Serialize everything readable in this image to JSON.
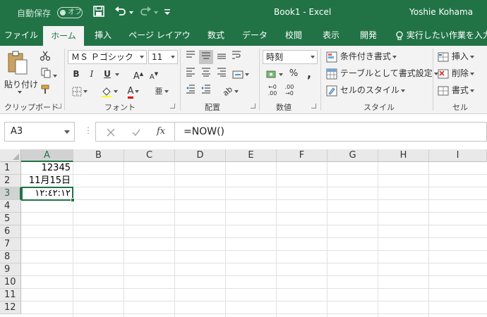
{
  "title_bar": {
    "autosave_label": "自動保存",
    "autosave_state": "オフ",
    "doc_title": "Book1  -  Excel",
    "user_name": "Yoshie Kohama"
  },
  "tabs": [
    {
      "label": "ファイル",
      "active": false
    },
    {
      "label": "ホーム",
      "active": true
    },
    {
      "label": "挿入",
      "active": false
    },
    {
      "label": "ページ レイアウト",
      "active": false
    },
    {
      "label": "数式",
      "active": false
    },
    {
      "label": "データ",
      "active": false
    },
    {
      "label": "校閲",
      "active": false
    },
    {
      "label": "表示",
      "active": false
    },
    {
      "label": "開発",
      "active": false
    },
    {
      "label": "実行したい作業を入力",
      "active": false
    }
  ],
  "ribbon": {
    "clipboard": {
      "paste_label": "貼り付け",
      "group_label": "クリップボード"
    },
    "font": {
      "font_name": "ＭＳ Ｐゴシック",
      "font_size": "11",
      "bold": "B",
      "italic": "I",
      "underline": "U",
      "group_label": "フォント"
    },
    "alignment": {
      "group_label": "配置"
    },
    "number": {
      "format": "時刻",
      "percent": "%",
      "group_label": "数値"
    },
    "styles": {
      "conditional": "条件付き書式",
      "table": "テーブルとして書式設定",
      "cell_styles": "セルのスタイル",
      "group_label": "スタイル"
    },
    "cells": {
      "insert": "挿入",
      "delete": "削除",
      "format": "書式",
      "group_label": "セル"
    }
  },
  "formula_bar": {
    "name_box": "A3",
    "formula": "=NOW()"
  },
  "sheet": {
    "columns": [
      "A",
      "B",
      "C",
      "D",
      "E",
      "F",
      "G",
      "H",
      "I"
    ],
    "rows": [
      "1",
      "2",
      "3",
      "4",
      "5",
      "6",
      "7",
      "8",
      "9",
      "10",
      "11",
      "12"
    ],
    "active_column": "A",
    "active_row": "3",
    "cells": {
      "A1": "12345",
      "A2": "11月15日",
      "A3": "١٢:٤٢:١٢"
    }
  }
}
